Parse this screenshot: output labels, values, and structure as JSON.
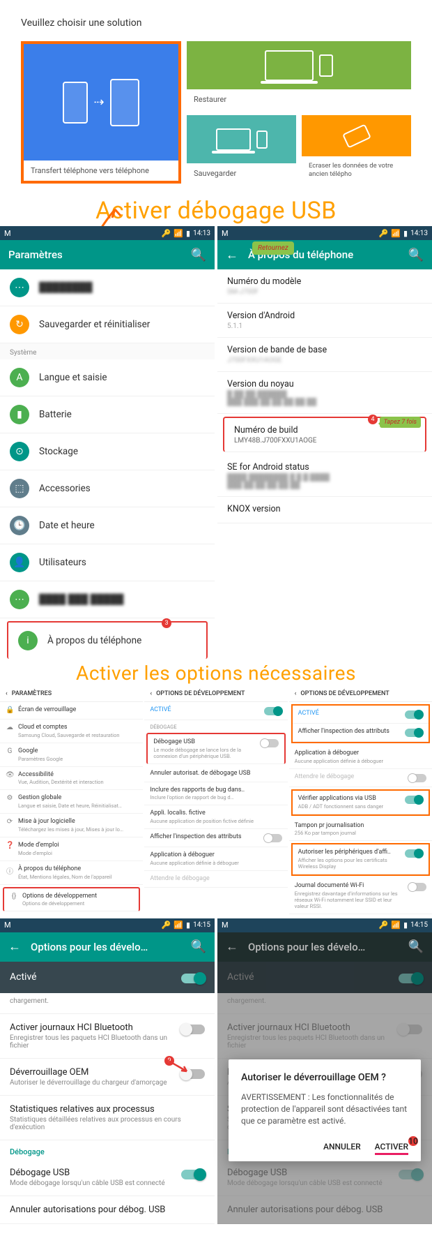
{
  "solution": {
    "title": "Veuillez choisir une solution",
    "tiles": {
      "transfer": "Transfert téléphone vers téléphone",
      "restore": "Restaurer",
      "backup": "Sauvegarder",
      "erase": "Ecraser les données de votre ancien télépho"
    }
  },
  "heading1": "Activer débogage USB",
  "heading2": "Activer les options nécessaires",
  "statusbar": {
    "time": "14:13",
    "time2": "14:15"
  },
  "settings": {
    "title": "Paramètres",
    "items": {
      "backup_reset": "Sauvegarder et réinitialiser",
      "system_header": "Système",
      "lang": "Langue et saisie",
      "battery": "Batterie",
      "storage": "Stockage",
      "accessories": "Accessories",
      "datetime": "Date et heure",
      "users": "Utilisateurs",
      "about": "À propos du téléphone"
    }
  },
  "about": {
    "retournez": "Retournez",
    "title": "À propos du téléphone",
    "model_k": "Numéro du modèle",
    "model_v": "SM-J700F",
    "android_k": "Version d'Android",
    "android_v": "5.1.1",
    "baseband_k": "Version de bande de base",
    "baseband_v": "J700FXXU1AOGE",
    "kernel_k": "Version du noyau",
    "build_k": "Numéro de build",
    "build_v": "LMY48B.J700FXXU1AOGE",
    "tapez": "Tapez 7 fois",
    "se_k": "SE for Android status",
    "knox_k": "KNOX version"
  },
  "params_small": {
    "title": "PARAMÈTRES",
    "lock": "Écran de verrouillage",
    "cloud": "Cloud et comptes",
    "cloud_sub": "Samsung Cloud, Sauvegarde et restauration",
    "google": "Google",
    "google_sub": "Paramètres Google",
    "access": "Accessibilité",
    "access_sub": "Vue, Audition, Dextérité et interaction",
    "gestion": "Gestion globale",
    "gestion_sub": "Langue et saisie, Date et heure, Réinitialisat…",
    "update": "Mise à jour logicielle",
    "update_sub": "Téléchargez les mises à jour, Mises à jour lo…",
    "manual": "Mode d'emploi",
    "manual_sub": "Mode d'emploi",
    "about": "À propos du téléphone",
    "about_sub": "État, Mentions légales, Nom de l'appareil",
    "devopts": "Options de développement",
    "devopts_sub": "Options de développement"
  },
  "dev_small": {
    "title": "OPTIONS DE DÉVELOPPEMENT",
    "active": "ACTIVÉ",
    "debug_section": "DÉBOGAGE",
    "usb": "Débogage USB",
    "usb_sub": "Le mode débogage se lance lors de la connexion d'un périphérique USB.",
    "revoke": "Annuler autorisat. de débogage USB",
    "bugreport": "Inclure des rapports de bug dans..",
    "bugreport_sub": "Inclure l'option de rapport de bug d…",
    "mock": "Appli. localis. fictive",
    "mock_sub": "Aucune application de position fictive définie",
    "inspect": "Afficher l'inspection des attributs",
    "appdebug": "Application à déboguer",
    "appdebug_sub": "Aucune application définie à déboguer",
    "wait": "Attendre le débogage"
  },
  "dev_small2": {
    "active": "ACTIVÉ",
    "inspect": "Afficher l'inspection des attributs",
    "appdebug": "Application à déboguer",
    "appdebug_sub": "Aucune application définie à déboguer",
    "wait": "Attendre le débogage",
    "verify": "Vérifier applications via USB",
    "verify_sub": "ADB / ADT fonctionnent sans danger",
    "log": "Tampon pr journalisation",
    "log_sub": "256 Ko par tampon journal",
    "periph": "Autoriser les périphériques d'affi..",
    "periph_sub": "Afficher les options pour les certificats Wireless Display",
    "wifi": "Journal documenté Wi-Fi",
    "wifi_sub": "Enregistrez davantage d'informations sur les réseaux Wi-Fi notamment leur SSID et leur valeur RSSI."
  },
  "devopts": {
    "title": "Options pour les dévelo…",
    "active": "Activé",
    "charging_sub": "chargement.",
    "hci": "Activer journaux HCI Bluetooth",
    "hci_sub": "Enregistrer tous les paquets HCI Bluetooth dans un fichier",
    "oem": "Déverrouillage OEM",
    "oem_sub": "Autoriser le déverrouillage du chargeur d'amorçage",
    "stats": "Statistiques relatives aux processus",
    "stats_sub": "Statistiques détaillées relatives aux processus en cours d'exécution",
    "debug_section": "Débogage",
    "usb": "Débogage USB",
    "usb_sub": "Mode débogage lorsqu'un câble USB est connecté",
    "revoke": "Annuler autorisations pour débog. USB"
  },
  "dialog": {
    "title": "Autoriser le déverrouillage OEM ?",
    "body": "AVERTISSEMENT : Les fonctionnalités de protection de l'appareil sont désactivées tant que ce paramètre est activé.",
    "cancel": "ANNULER",
    "ok": "ACTIVER"
  }
}
